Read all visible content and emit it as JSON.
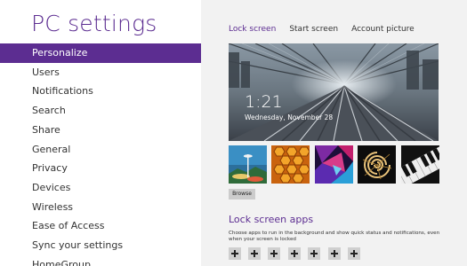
{
  "sidebar": {
    "title": "PC settings",
    "items": [
      {
        "label": "Personalize"
      },
      {
        "label": "Users"
      },
      {
        "label": "Notifications"
      },
      {
        "label": "Search"
      },
      {
        "label": "Share"
      },
      {
        "label": "General"
      },
      {
        "label": "Privacy"
      },
      {
        "label": "Devices"
      },
      {
        "label": "Wireless"
      },
      {
        "label": "Ease of Access"
      },
      {
        "label": "Sync your settings"
      },
      {
        "label": "HomeGroup"
      }
    ]
  },
  "main": {
    "tabs": [
      {
        "label": "Lock screen"
      },
      {
        "label": "Start screen"
      },
      {
        "label": "Account picture"
      }
    ],
    "lock_preview": {
      "time": "1:21",
      "date": "Wednesday, November 28"
    },
    "background_thumbnails": [
      {
        "icon": "space-needle-image"
      },
      {
        "icon": "honeycomb-image"
      },
      {
        "icon": "geometric-shapes-image"
      },
      {
        "icon": "nautilus-shell-image"
      },
      {
        "icon": "piano-keys-image"
      }
    ],
    "browse_label": "Browse",
    "lock_apps_title": "Lock screen apps",
    "lock_apps_description": "Choose apps to run in the background and show quick status and notifications, even when your screen is locked",
    "app_slots": [
      {
        "icon": "plus-icon"
      },
      {
        "icon": "plus-icon"
      },
      {
        "icon": "plus-icon"
      },
      {
        "icon": "plus-icon"
      },
      {
        "icon": "plus-icon"
      },
      {
        "icon": "plus-icon"
      },
      {
        "icon": "plus-icon"
      }
    ]
  },
  "colors": {
    "accent": "#5c2d91",
    "sidebar_background": "#ffffff",
    "content_background": "#f2f2f2"
  }
}
